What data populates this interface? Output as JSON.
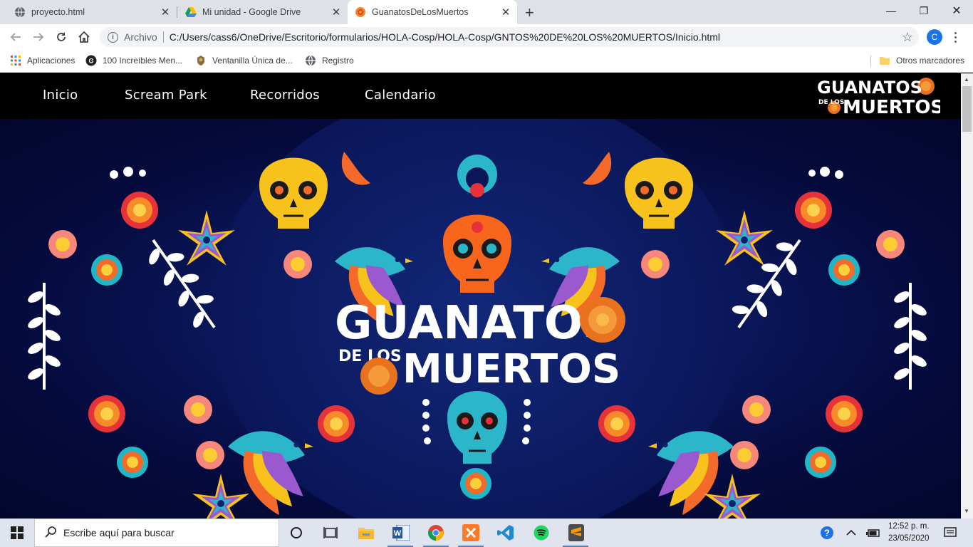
{
  "browser": {
    "tabs": [
      {
        "title": "proyecto.html",
        "icon": "globe-icon",
        "active": false
      },
      {
        "title": "Mi unidad - Google Drive",
        "icon": "google-drive-icon",
        "active": false
      },
      {
        "title": "GuanatosDeLosMuertos",
        "icon": "marigold-icon",
        "active": true
      }
    ],
    "omnibox": {
      "scheme_label": "Archivo",
      "url": "C:/Users/cass6/OneDrive/Escritorio/formularios/HOLA-Cosp/HOLA-Cosp/GNTOS%20DE%20LOS%20MUERTOS/Inicio.html"
    },
    "profile_initial": "C",
    "bookmarks": [
      {
        "label": "Aplicaciones",
        "icon": "apps-grid-icon"
      },
      {
        "label": "100 Increíbles Men...",
        "icon": "bookmark-site-icon"
      },
      {
        "label": "Ventanilla Única de...",
        "icon": "crest-icon"
      },
      {
        "label": "Registro",
        "icon": "globe-icon"
      }
    ],
    "other_bookmarks": "Otros marcadores"
  },
  "site": {
    "nav": [
      "Inicio",
      "Scream Park",
      "Recorridos",
      "Calendario"
    ],
    "logo_line1": "GUANATOS",
    "logo_line2_small": "DE LOS",
    "logo_line2_big": "MUERTOS",
    "hero_title_line1": "GUANATOS",
    "hero_title_small": "DE LOS",
    "hero_title_line2": "MUERTOS"
  },
  "taskbar": {
    "search_placeholder": "Escribe aquí para buscar",
    "time": "12:52 p. m.",
    "date": "23/05/2020",
    "apps": [
      "task-view-icon",
      "cortana-icon",
      "file-explorer-icon",
      "word-icon",
      "chrome-icon",
      "xampp-icon",
      "vscode-icon",
      "spotify-icon",
      "sublime-text-icon"
    ]
  },
  "colors": {
    "hero_bg": "#0a1658",
    "nav_bg": "#000000",
    "skull_yellow": "#f6c21b",
    "skull_orange": "#f7661c",
    "skull_teal": "#2bb7c9"
  }
}
